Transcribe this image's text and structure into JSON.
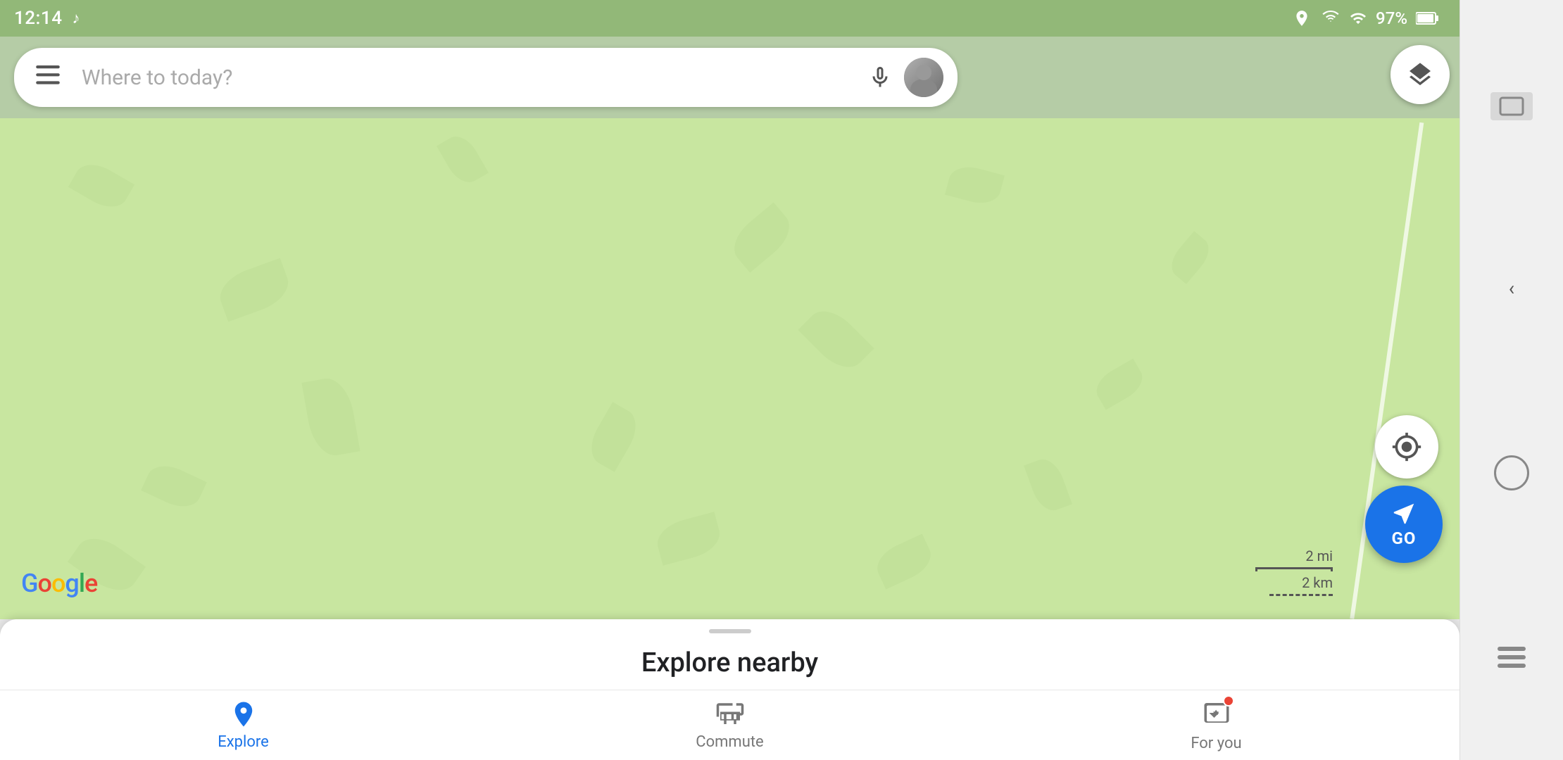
{
  "status_bar": {
    "time": "12:14",
    "music_note": "♪",
    "battery_percent": "97%",
    "icons": {
      "location": "📍",
      "wifi": "wifi",
      "signal": "signal",
      "battery": "battery"
    }
  },
  "search": {
    "placeholder": "Where to today?",
    "hamburger_label": "☰"
  },
  "map": {
    "scale_mi": "2 mi",
    "scale_km": "2 km",
    "google_logo": "Google"
  },
  "buttons": {
    "go_label": "GO",
    "layer_label": "Layers"
  },
  "bottom_panel": {
    "explore_nearby_title": "Explore nearby",
    "drag_handle": ""
  },
  "bottom_nav": {
    "items": [
      {
        "id": "explore",
        "label": "Explore",
        "active": true
      },
      {
        "id": "commute",
        "label": "Commute",
        "active": false
      },
      {
        "id": "for-you",
        "label": "For you",
        "active": false,
        "has_notification": true
      }
    ]
  }
}
